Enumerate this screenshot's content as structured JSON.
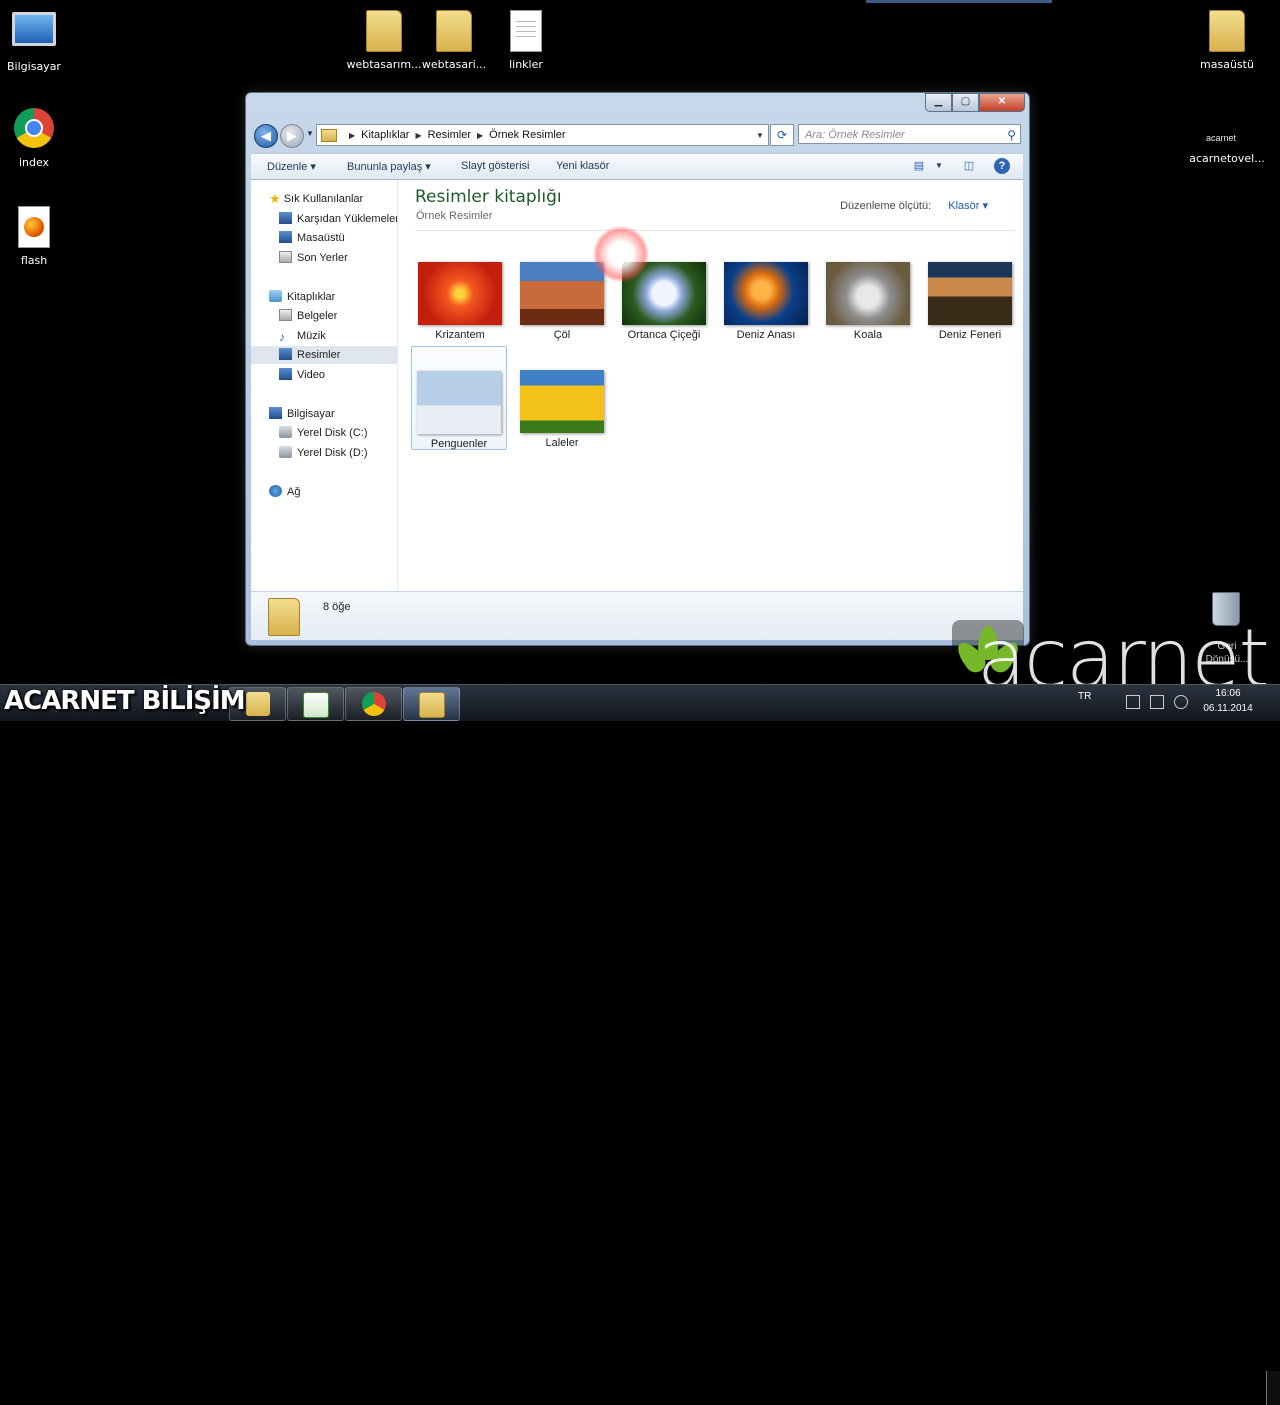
{
  "desktop": {
    "icons": [
      {
        "label": "Bilgisayar",
        "icon": "computer-icon"
      },
      {
        "label": "index",
        "icon": "chrome-icon"
      },
      {
        "label": "flash",
        "icon": "firefox-document-icon"
      },
      {
        "label": "webtasarım...",
        "icon": "folder-icon"
      },
      {
        "label": "webtasari...",
        "icon": "folder-icon"
      },
      {
        "label": "linkler",
        "icon": "text-document-icon"
      },
      {
        "label": "masaüstü",
        "icon": "folder-icon"
      },
      {
        "label": "acarnetovel...",
        "icon": "acarnet-icon"
      }
    ],
    "acarnet_small_logo": "acarnet",
    "recycle_bin_label": "Geri Dönüşü..."
  },
  "window": {
    "breadcrumb": [
      "Kitaplıklar",
      "Resimler",
      "Örnek Resimler"
    ],
    "search_placeholder": "Ara: Örnek Resimler",
    "toolbar": {
      "organize": "Düzenle",
      "share": "Bununla paylaş",
      "slideshow": "Slayt gösterisi",
      "new_folder": "Yeni klasör"
    },
    "nav": {
      "favorites_header": "Sık Kullanılanlar",
      "favorites": [
        "Karşıdan Yüklemeler",
        "Masaüstü",
        "Son Yerler"
      ],
      "libraries_header": "Kitaplıklar",
      "libraries": [
        "Belgeler",
        "Müzik",
        "Resimler",
        "Video"
      ],
      "computer_header": "Bilgisayar",
      "drives": [
        "Yerel Disk (C:)",
        "Yerel Disk (D:)"
      ],
      "network": "Ağ"
    },
    "main": {
      "title": "Resimler kitaplığı",
      "subtitle": "Örnek Resimler",
      "arrange_label": "Düzenleme ölçütü:",
      "arrange_value": "Klasör",
      "items": [
        "Krizantem",
        "Çöl",
        "Ortanca Çiçeği",
        "Deniz Anası",
        "Koala",
        "Deniz Feneri",
        "Penguenler",
        "Laleler"
      ]
    },
    "details": {
      "count": "8 öğe"
    }
  },
  "taskbar": {
    "brand": "ACARNET BİLİŞİM",
    "language": "TR",
    "time": "16:06",
    "date": "06.11.2014"
  },
  "watermark": "acarnet",
  "colors": {
    "library_title": "#1e5b2a",
    "link_blue": "#1f5ba8",
    "close_red": "#c2422a"
  }
}
